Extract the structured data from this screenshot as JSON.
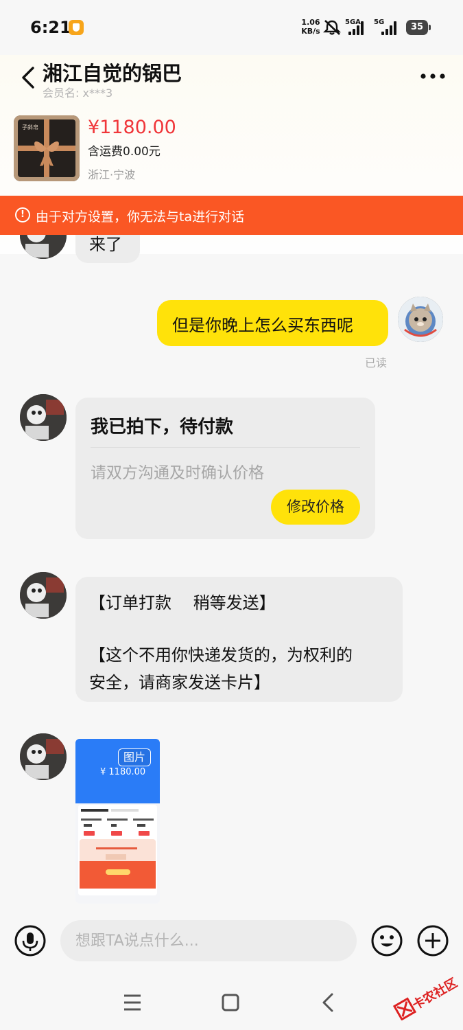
{
  "status_bar": {
    "time": "6:21",
    "speed_value": "1.06",
    "speed_unit": "KB/s",
    "sim1_label": "5GA",
    "sim2_label": "5G",
    "battery": "35"
  },
  "header": {
    "seller_name": "湘江自觉的锅巴",
    "member_label": "会员名:",
    "member_id": "x***3"
  },
  "product": {
    "price": "¥1180.00",
    "shipping": "含运费0.00元",
    "location": "浙江·宁波",
    "thumb_text": "子斜帛"
  },
  "warning": {
    "text": "由于对方设置，你无法与ta进行对话",
    "icon": "!"
  },
  "messages": {
    "partial": "来了",
    "outgoing": "但是你晚上怎么买东西呢",
    "read_status": "已读",
    "order_card": {
      "title": "我已拍下，待付款",
      "subtitle": "请双方沟通及时确认价格",
      "button": "修改价格"
    },
    "long_text_line1": "【订单打款　 稍等发送】",
    "long_text_line2": "【这个不用你快递发货的，为权利的",
    "long_text_line3": "安全，请商家发送卡片】",
    "image_tag": "图片",
    "image_amount": "¥ 1180.00"
  },
  "input": {
    "placeholder": "想跟TA说点什么..."
  },
  "watermark": {
    "text": "卡农社区"
  },
  "colors": {
    "accent_yellow": "#ffe20a",
    "warning_orange": "#fa5724",
    "price_red": "#f0363a"
  }
}
